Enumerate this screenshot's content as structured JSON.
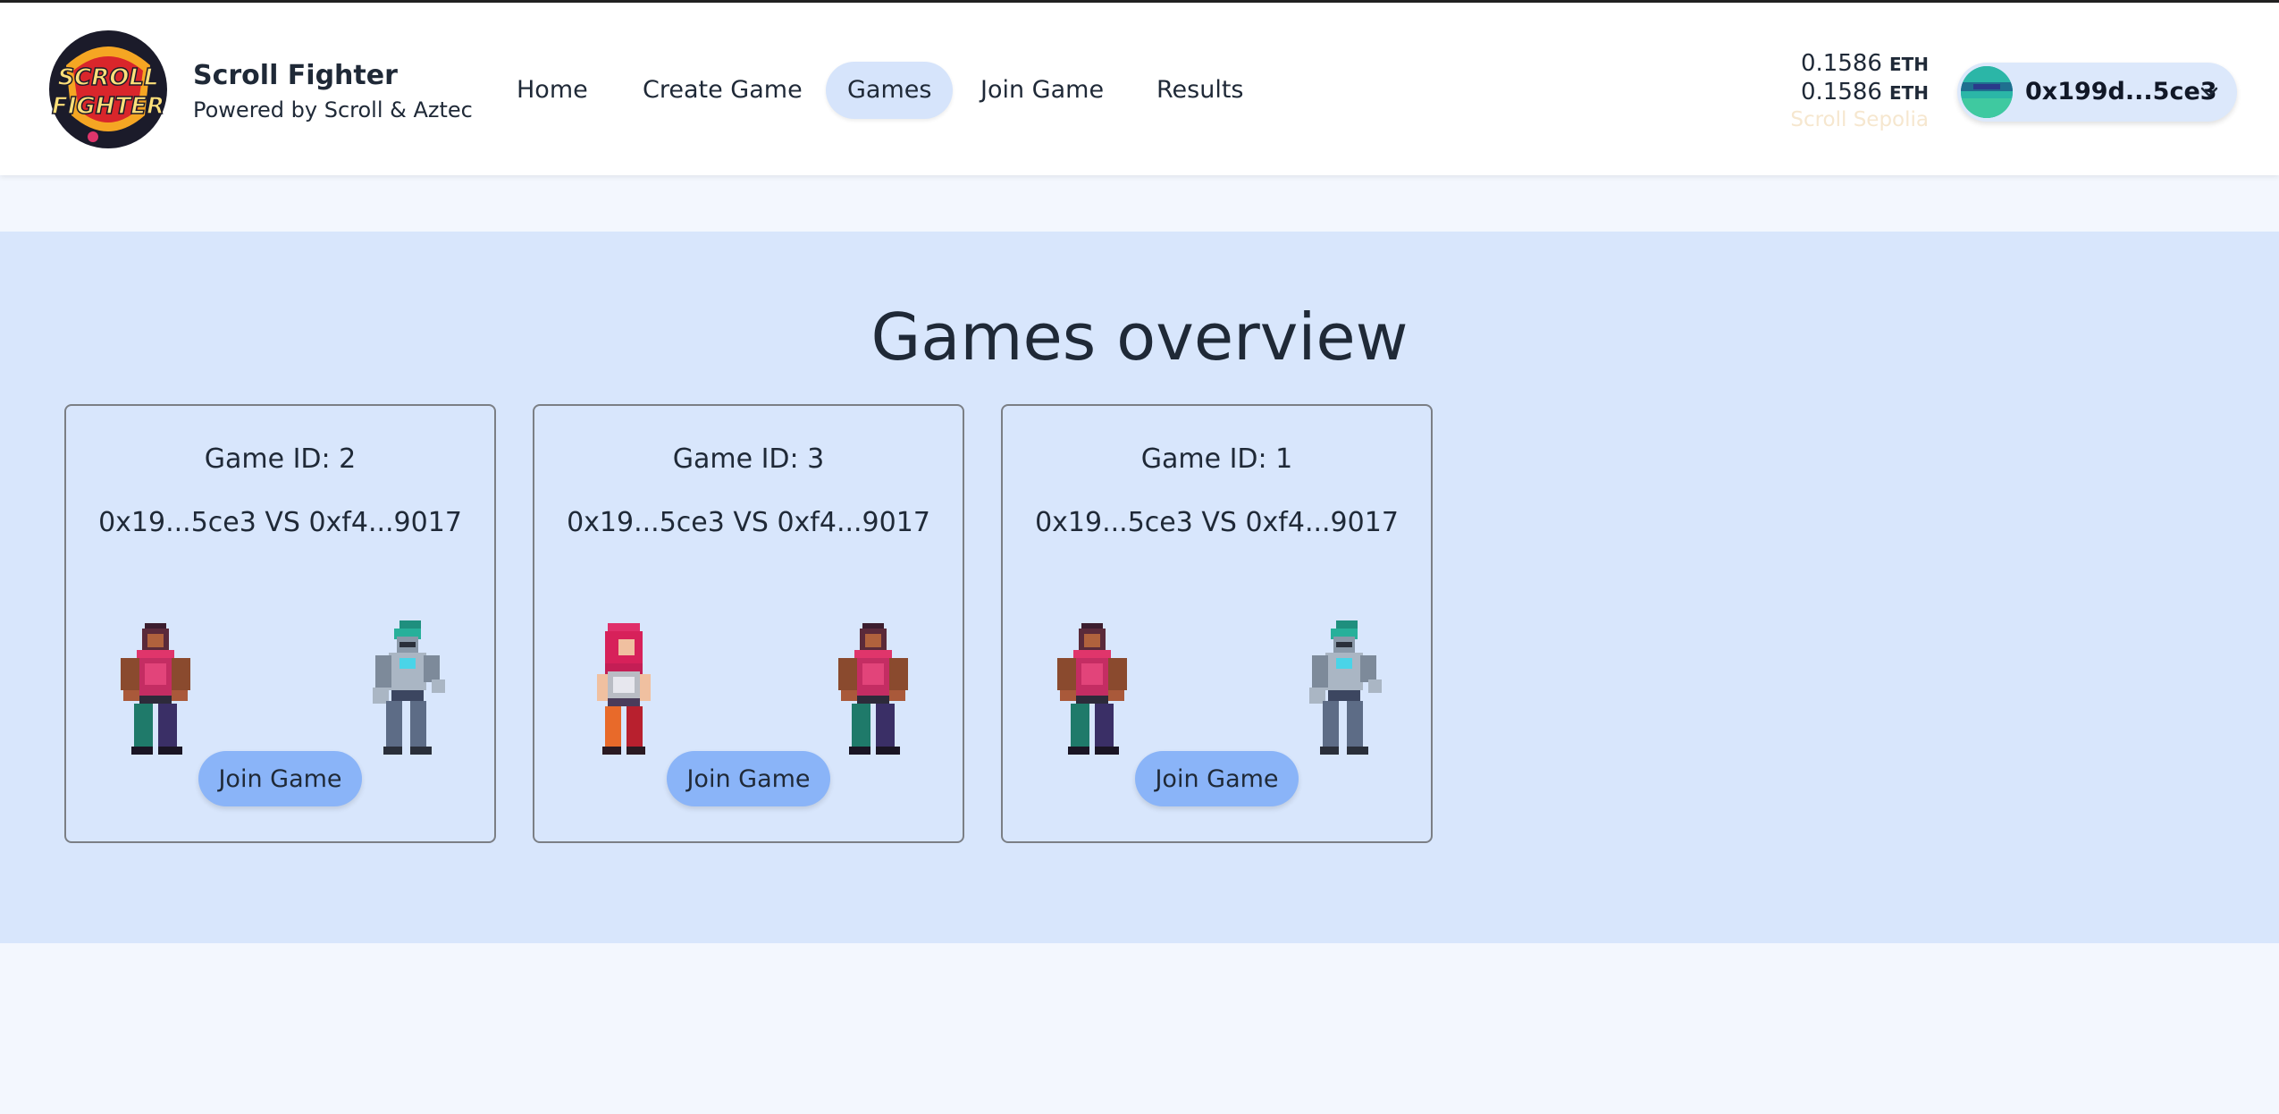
{
  "brand": {
    "logo_text": "SCROLL FIGHTER",
    "title": "Scroll Fighter",
    "subtitle": "Powered by Scroll & Aztec"
  },
  "nav": {
    "items": [
      {
        "label": "Home",
        "active": false
      },
      {
        "label": "Create Game",
        "active": false
      },
      {
        "label": "Games",
        "active": true
      },
      {
        "label": "Join Game",
        "active": false
      },
      {
        "label": "Results",
        "active": false
      }
    ]
  },
  "wallet": {
    "balances": [
      {
        "amount": "0.1586",
        "unit": "ETH"
      },
      {
        "amount": "0.1586",
        "unit": "ETH"
      }
    ],
    "network": "Scroll Sepolia",
    "account": "0x199d...5ce3",
    "icons": {
      "dropdown": "chevron-down-icon"
    }
  },
  "main": {
    "title": "Games overview",
    "games": [
      {
        "id_label": "Game ID: 2",
        "matchup": "0x19...5ce3 VS 0xf4...9017",
        "left_fighter": "brawler",
        "right_fighter": "cyborg",
        "button_label": "Join Game"
      },
      {
        "id_label": "Game ID: 3",
        "matchup": "0x19...5ce3 VS 0xf4...9017",
        "left_fighter": "redhead",
        "right_fighter": "brawler",
        "button_label": "Join Game"
      },
      {
        "id_label": "Game ID: 1",
        "matchup": "0x19...5ce3 VS 0xf4...9017",
        "left_fighter": "brawler",
        "right_fighter": "cyborg",
        "button_label": "Join Game"
      }
    ]
  },
  "colors": {
    "page_bg": "#f3f7fe",
    "band_bg": "#d8e6fc",
    "button_bg": "#8ab4f8",
    "nav_active_bg": "#d6e4fb",
    "network_text": "#f6e7cf"
  }
}
